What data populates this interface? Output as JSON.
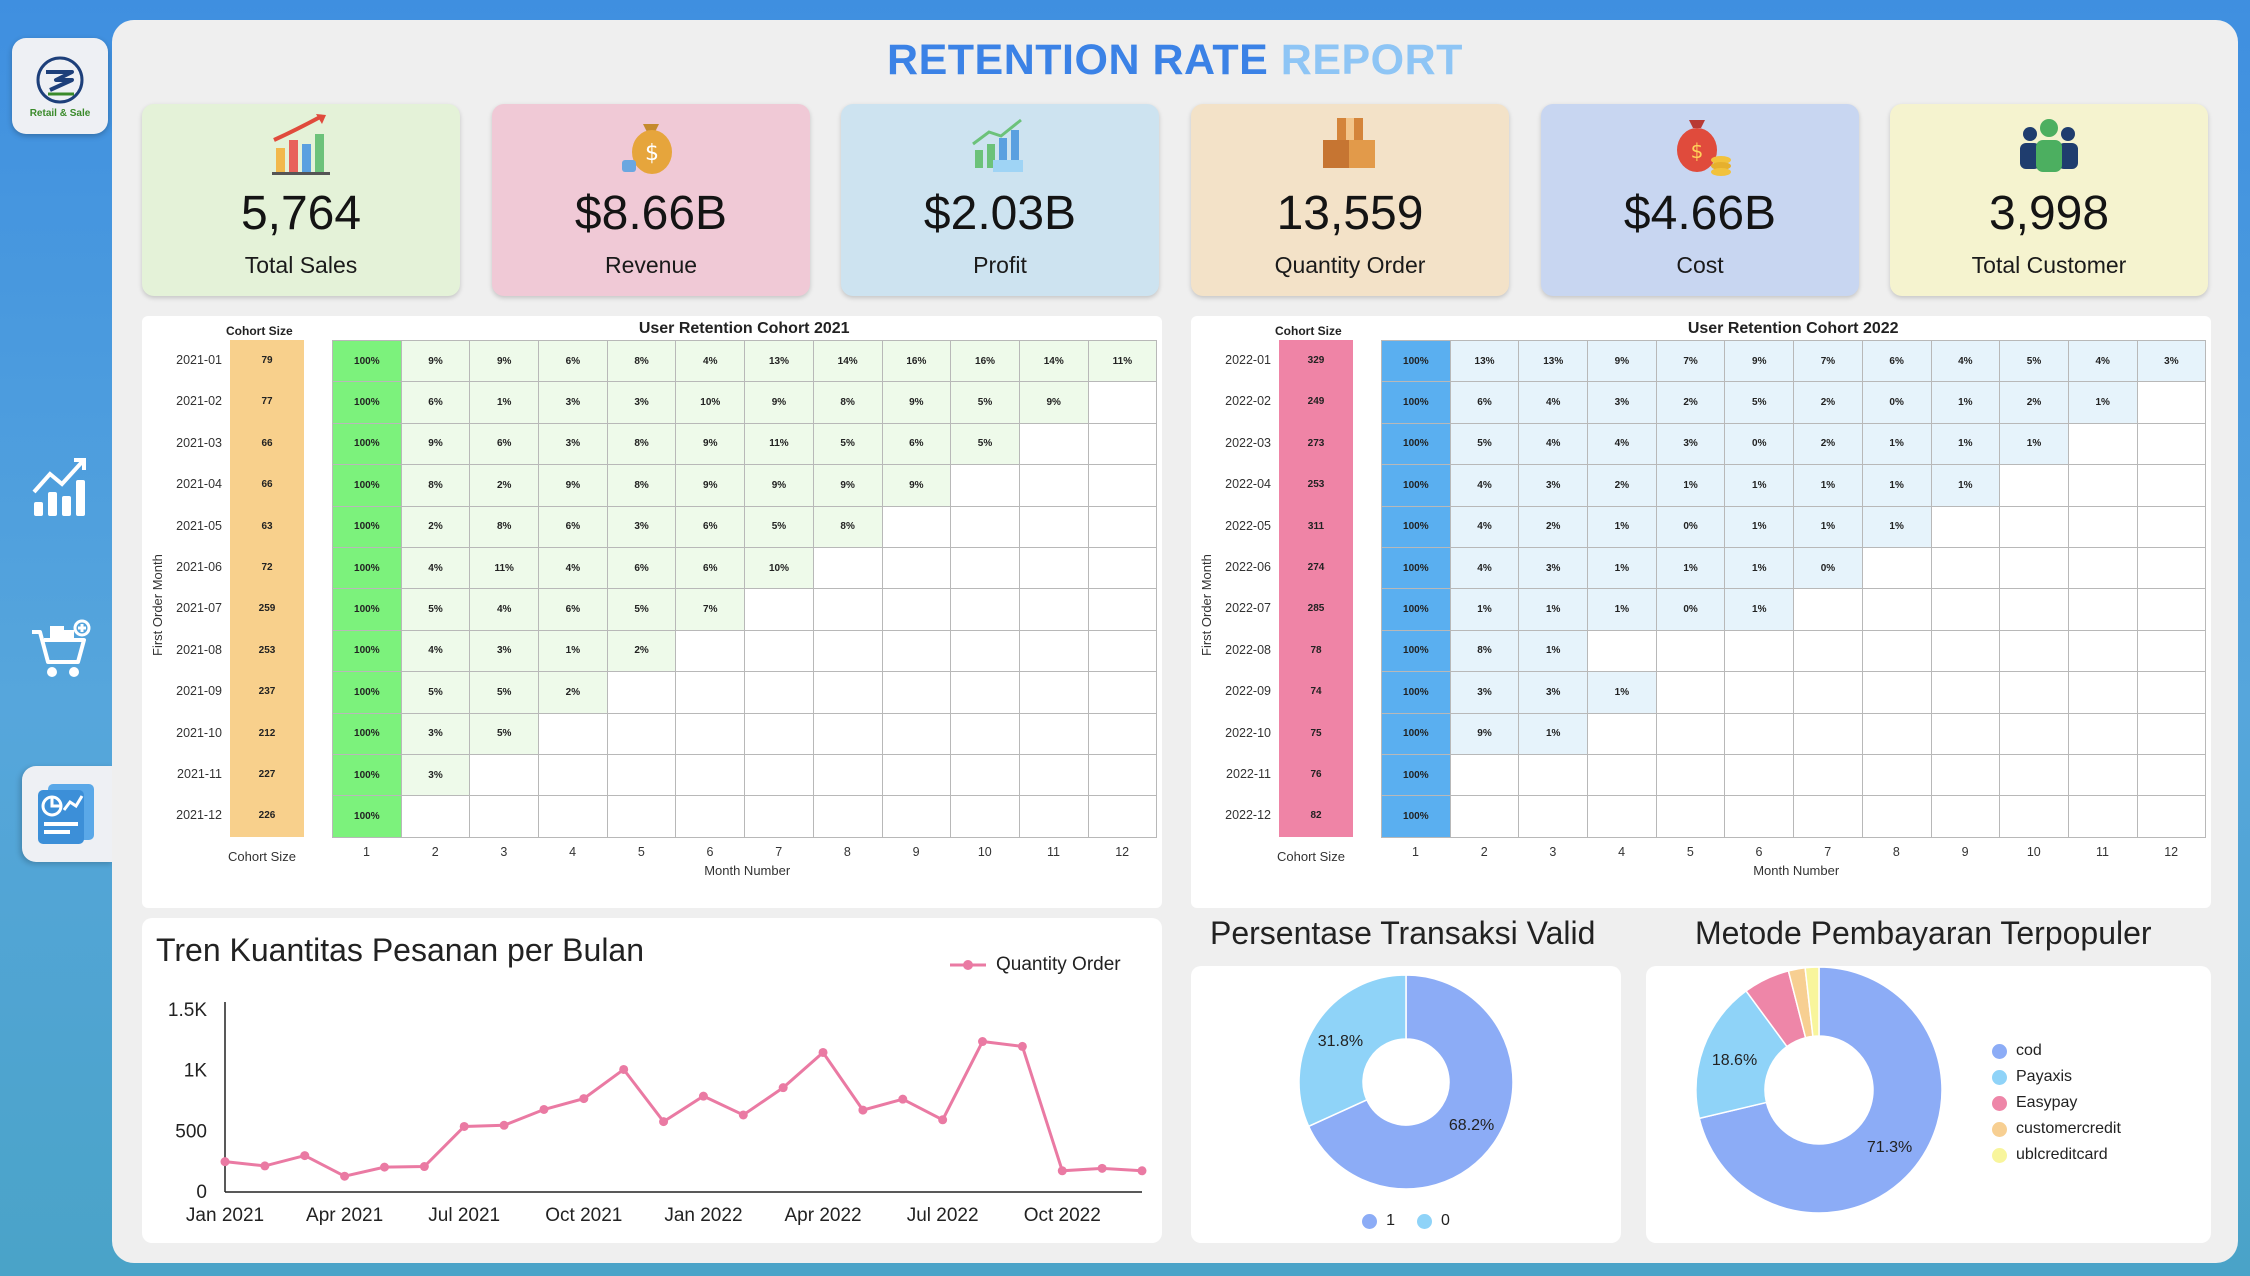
{
  "app": {
    "logo_text": "Retail & Sale"
  },
  "report": {
    "title_part1": "RETENTION RATE",
    "title_part2": "REPORT"
  },
  "nav": [
    {
      "icon": "bar-chart-icon"
    },
    {
      "icon": "shopping-cart-icon"
    },
    {
      "icon": "report-icon",
      "active": true
    }
  ],
  "kpis": [
    {
      "value": "5,764",
      "label": "Total Sales",
      "bg": "#e4f2d8",
      "icon": "sales-chart-icon"
    },
    {
      "value": "$8.66B",
      "label": "Revenue",
      "bg": "#f0c9d6",
      "icon": "money-bag-icon"
    },
    {
      "value": "$2.03B",
      "label": "Profit",
      "bg": "#cde3f0",
      "icon": "profit-chart-icon"
    },
    {
      "value": "13,559",
      "label": "Quantity Order",
      "bg": "#f3e2c8",
      "icon": "boxes-icon"
    },
    {
      "value": "$4.66B",
      "label": "Cost",
      "bg": "#c8d6f1",
      "icon": "cost-bag-icon"
    },
    {
      "value": "3,998",
      "label": "Total Customer",
      "bg": "#f5f3cf",
      "icon": "customers-icon"
    }
  ],
  "cohorts": [
    {
      "title": "User Retention Cohort 2021",
      "cohort_size_label": "Cohort Size",
      "y_axis_label": "First Order Month",
      "x_axis_label": "Month Number",
      "x_ticks": [
        "1",
        "2",
        "3",
        "4",
        "5",
        "6",
        "7",
        "8",
        "9",
        "10",
        "11",
        "12"
      ],
      "rows": [
        "2021-01",
        "2021-02",
        "2021-03",
        "2021-04",
        "2021-05",
        "2021-06",
        "2021-07",
        "2021-08",
        "2021-09",
        "2021-10",
        "2021-11",
        "2021-12"
      ],
      "sizes": [
        "79",
        "77",
        "66",
        "66",
        "63",
        "72",
        "259",
        "253",
        "237",
        "212",
        "227",
        "226"
      ],
      "size_color": "#f8d08c",
      "first_color": "#7cf27c",
      "cell_color": "#eefaea",
      "values": [
        [
          "100%",
          "9%",
          "9%",
          "6%",
          "8%",
          "4%",
          "13%",
          "14%",
          "16%",
          "16%",
          "14%",
          "11%"
        ],
        [
          "100%",
          "6%",
          "1%",
          "3%",
          "3%",
          "10%",
          "9%",
          "8%",
          "9%",
          "5%",
          "9%"
        ],
        [
          "100%",
          "9%",
          "6%",
          "3%",
          "8%",
          "9%",
          "11%",
          "5%",
          "6%",
          "5%"
        ],
        [
          "100%",
          "8%",
          "2%",
          "9%",
          "8%",
          "9%",
          "9%",
          "9%",
          "9%"
        ],
        [
          "100%",
          "2%",
          "8%",
          "6%",
          "3%",
          "6%",
          "5%",
          "8%"
        ],
        [
          "100%",
          "4%",
          "11%",
          "4%",
          "6%",
          "6%",
          "10%"
        ],
        [
          "100%",
          "5%",
          "4%",
          "6%",
          "5%",
          "7%"
        ],
        [
          "100%",
          "4%",
          "3%",
          "1%",
          "2%"
        ],
        [
          "100%",
          "5%",
          "5%",
          "2%"
        ],
        [
          "100%",
          "3%",
          "5%"
        ],
        [
          "100%",
          "3%"
        ],
        [
          "100%"
        ]
      ]
    },
    {
      "title": "User Retention Cohort 2022",
      "cohort_size_label": "Cohort Size",
      "y_axis_label": "First Order Month",
      "x_axis_label": "Month Number",
      "x_ticks": [
        "1",
        "2",
        "3",
        "4",
        "5",
        "6",
        "7",
        "8",
        "9",
        "10",
        "11",
        "12"
      ],
      "rows": [
        "2022-01",
        "2022-02",
        "2022-03",
        "2022-04",
        "2022-05",
        "2022-06",
        "2022-07",
        "2022-08",
        "2022-09",
        "2022-10",
        "2022-11",
        "2022-12"
      ],
      "sizes": [
        "329",
        "249",
        "273",
        "253",
        "311",
        "274",
        "285",
        "78",
        "74",
        "75",
        "76",
        "82"
      ],
      "size_color": "#ef84a6",
      "first_color": "#5aaff0",
      "cell_color": "#e6f3fb",
      "values": [
        [
          "100%",
          "13%",
          "13%",
          "9%",
          "7%",
          "9%",
          "7%",
          "6%",
          "4%",
          "5%",
          "4%",
          "3%"
        ],
        [
          "100%",
          "6%",
          "4%",
          "3%",
          "2%",
          "5%",
          "2%",
          "0%",
          "1%",
          "2%",
          "1%"
        ],
        [
          "100%",
          "5%",
          "4%",
          "4%",
          "3%",
          "0%",
          "2%",
          "1%",
          "1%",
          "1%"
        ],
        [
          "100%",
          "4%",
          "3%",
          "2%",
          "1%",
          "1%",
          "1%",
          "1%",
          "1%"
        ],
        [
          "100%",
          "4%",
          "2%",
          "1%",
          "0%",
          "1%",
          "1%",
          "1%"
        ],
        [
          "100%",
          "4%",
          "3%",
          "1%",
          "1%",
          "1%",
          "0%"
        ],
        [
          "100%",
          "1%",
          "1%",
          "1%",
          "0%",
          "1%"
        ],
        [
          "100%",
          "8%",
          "1%"
        ],
        [
          "100%",
          "3%",
          "3%",
          "1%"
        ],
        [
          "100%",
          "9%",
          "1%"
        ],
        [
          "100%"
        ],
        [
          "100%"
        ]
      ]
    }
  ],
  "line_panel": {
    "title": "Tren Kuantitas Pesanan per Bulan",
    "legend": "Quantity Order",
    "line_color": "#ea7aa3"
  },
  "donut_valid": {
    "title": "Persentase Transaksi Valid",
    "slices": [
      {
        "label": "1",
        "value": 68.2,
        "text": "68.2%",
        "color": "#8cacf6"
      },
      {
        "label": "0",
        "value": 31.8,
        "text": "31.8%",
        "color": "#8fd3f8"
      }
    ]
  },
  "donut_payment": {
    "title": "Metode Pembayaran Terpopuler",
    "slices": [
      {
        "label": "cod",
        "value": 71.3,
        "text": "71.3%",
        "color": "#8cacf6"
      },
      {
        "label": "Payaxis",
        "value": 18.6,
        "text": "18.6%",
        "color": "#8fd3f8"
      },
      {
        "label": "Easypay",
        "value": 6.1,
        "text": "",
        "color": "#ee86a8"
      },
      {
        "label": "customercredit",
        "value": 2.2,
        "text": "",
        "color": "#f7cf92"
      },
      {
        "label": "ublcreditcard",
        "value": 1.8,
        "text": "",
        "color": "#f8f59c"
      }
    ]
  },
  "chart_data": [
    {
      "type": "line",
      "title": "Tren Kuantitas Pesanan per Bulan",
      "series": [
        {
          "name": "Quantity Order",
          "values": [
            250,
            215,
            300,
            130,
            205,
            210,
            540,
            550,
            680,
            770,
            1010,
            580,
            790,
            635,
            860,
            1150,
            675,
            765,
            595,
            1240,
            1200,
            175,
            195,
            175
          ]
        }
      ],
      "x": [
        "Jan 2021",
        "Feb 2021",
        "Mar 2021",
        "Apr 2021",
        "May 2021",
        "Jun 2021",
        "Jul 2021",
        "Aug 2021",
        "Sep 2021",
        "Oct 2021",
        "Nov 2021",
        "Dec 2021",
        "Jan 2022",
        "Feb 2022",
        "Mar 2022",
        "Apr 2022",
        "May 2022",
        "Jun 2022",
        "Jul 2022",
        "Aug 2022",
        "Sep 2022",
        "Oct 2022",
        "Nov 2022",
        "Dec 2022"
      ],
      "x_tick_labels": [
        "Jan 2021",
        "Apr 2021",
        "Jul 2021",
        "Oct 2021",
        "Jan 2022",
        "Apr 2022",
        "Jul 2022",
        "Oct 2022"
      ],
      "y_tick_labels": [
        "0",
        "500",
        "1K",
        "1.5K"
      ],
      "ylim": [
        0,
        1500
      ]
    },
    {
      "type": "pie",
      "title": "Persentase Transaksi Valid",
      "categories": [
        "1",
        "0"
      ],
      "values": [
        68.2,
        31.8
      ]
    },
    {
      "type": "pie",
      "title": "Metode Pembayaran Terpopuler",
      "categories": [
        "cod",
        "Payaxis",
        "Easypay",
        "customercredit",
        "ublcreditcard"
      ],
      "values": [
        71.3,
        18.6,
        6.1,
        2.2,
        1.8
      ]
    }
  ]
}
